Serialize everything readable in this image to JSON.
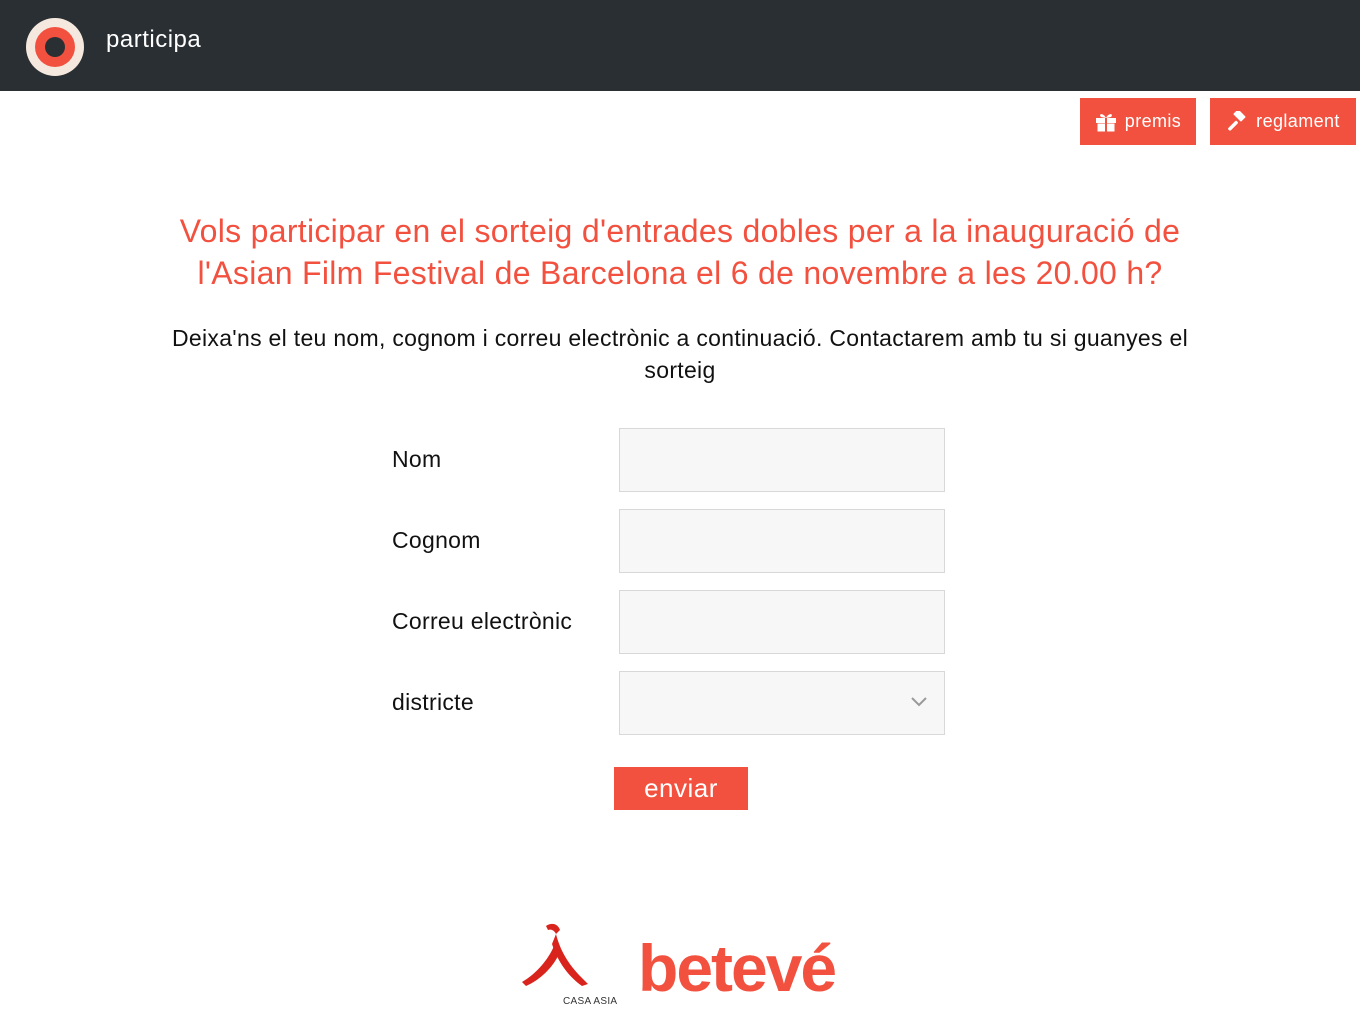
{
  "header": {
    "brand": "participa",
    "premis_label": "premis",
    "reglament_label": "reglament"
  },
  "main": {
    "headline_line1": "Vols participar en el sorteig d'entrades dobles per a la inauguració de",
    "headline_line2": "l'Asian Film Festival de Barcelona el 6 de novembre a les 20.00 h?",
    "intro_line1": "Deixa'ns el teu nom, cognom i correu electrònic a continuació. Contactarem amb tu si guanyes el",
    "intro_line2": "sorteig"
  },
  "form": {
    "nom_label": "Nom",
    "nom_value": "",
    "cognom_label": "Cognom",
    "cognom_value": "",
    "email_label": "Correu electrònic",
    "email_value": "",
    "districte_label": "districte",
    "districte_value": "",
    "submit_label": "enviar"
  },
  "footer": {
    "casa_asia_text": "CASA ASIA",
    "beteve_text": "betevé"
  },
  "colors": {
    "accent": "#f2513f",
    "topbar": "#2a2f33"
  },
  "icons": {
    "premis": "gift-icon",
    "reglament": "gavel-icon",
    "select": "chevron-down-icon"
  }
}
